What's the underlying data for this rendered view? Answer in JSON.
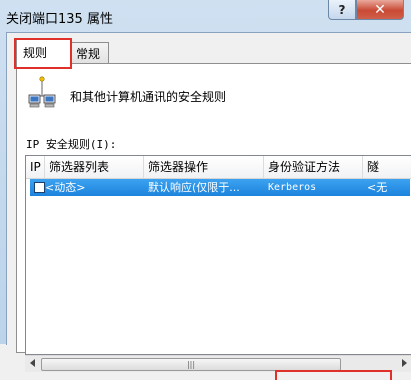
{
  "window": {
    "title": "关闭端口135 属性",
    "help_label": "?",
    "close_label": "✕"
  },
  "tabs": [
    {
      "label": "规则",
      "selected": true
    },
    {
      "label": "常规",
      "selected": false
    }
  ],
  "rules_tab": {
    "icon": "network-computers-icon",
    "description": "和其他计算机通讯的安全规则",
    "list_label": "IP 安全规则(I):",
    "columns": [
      "IP",
      "筛选器列表",
      "筛选器操作",
      "身份验证方法",
      "隧"
    ],
    "rows": [
      {
        "checked": false,
        "filter_list": "<动态>",
        "filter_action": "默认响应(仅限于...",
        "auth_method": "Kerberos",
        "tunnel": "<无"
      }
    ],
    "scrollbar_grip": "|||"
  },
  "colors": {
    "highlight_box": "#e0302a",
    "selected_row": "#1c83dd",
    "title_bar": "#cfe0f1"
  }
}
